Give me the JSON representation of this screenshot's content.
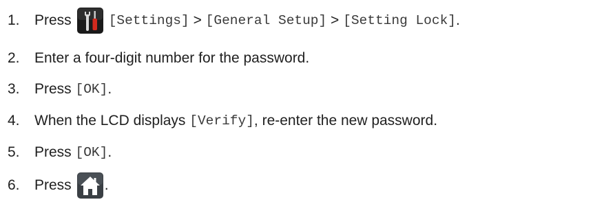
{
  "steps": [
    {
      "number": "1.",
      "parts": {
        "press": "Press",
        "settings": "[Settings]",
        "sep1": ">",
        "general": "[General Setup]",
        "sep2": ">",
        "lock": "[Setting Lock]",
        "end": "."
      },
      "icon": "settings-tools-icon"
    },
    {
      "number": "2.",
      "text": "Enter a four-digit number for the password."
    },
    {
      "number": "3.",
      "parts": {
        "press": "Press",
        "ok": "[OK]",
        "end": "."
      }
    },
    {
      "number": "4.",
      "parts": {
        "before": "When the LCD displays",
        "verify": "[Verify]",
        "after": ", re-enter the new password."
      }
    },
    {
      "number": "5.",
      "parts": {
        "press": "Press",
        "ok": "[OK]",
        "end": "."
      }
    },
    {
      "number": "6.",
      "parts": {
        "press": "Press",
        "end": "."
      },
      "icon": "home-icon"
    }
  ],
  "colors": {
    "text": "#1f1f1f",
    "icon_bg": "#1a1a1a",
    "home_bg": "#3a3f44",
    "screwdriver_red": "#d22a1e"
  }
}
